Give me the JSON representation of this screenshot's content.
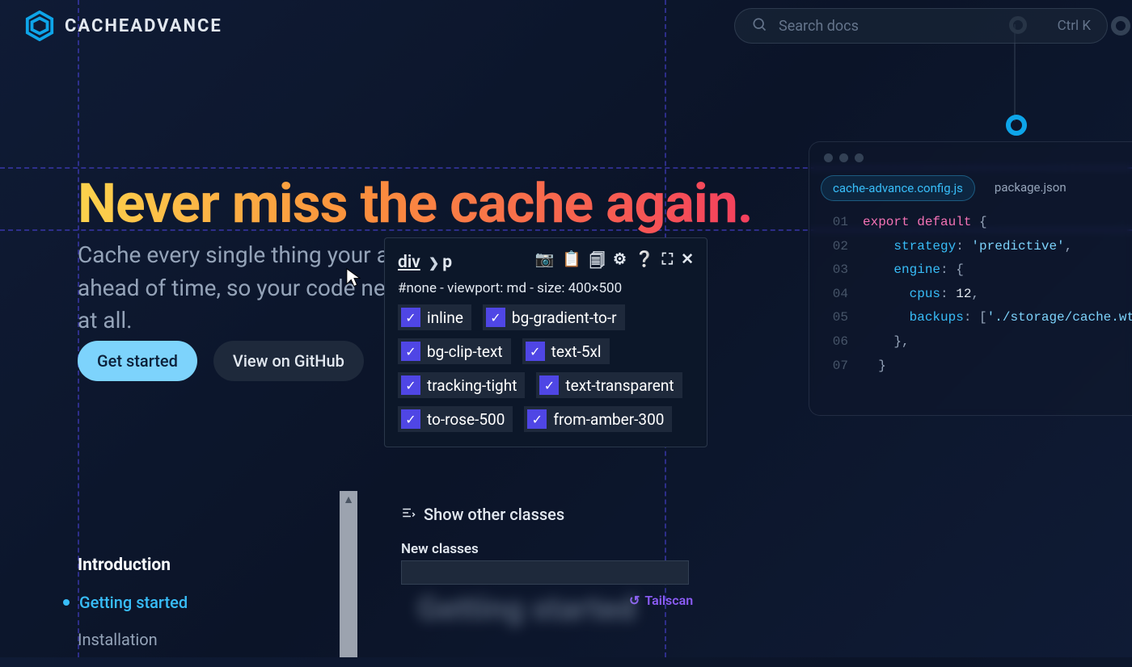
{
  "brand": "CACHEADVANCE",
  "search": {
    "placeholder": "Search docs",
    "kbd": "Ctrl K"
  },
  "hero": {
    "title": "Never miss the cache again.",
    "subtitle": "Cache every single thing your app could ever do ahead of time, so your code never even has to run at all."
  },
  "buttons": {
    "primary": "Get started",
    "secondary": "View on GitHub"
  },
  "sidebar": {
    "section": "Introduction",
    "links": [
      "Getting started",
      "Installation"
    ]
  },
  "inspector": {
    "breadcrumb_parent": "div",
    "breadcrumb_current": "p",
    "meta": "#none - viewport: md - size: 400×500",
    "classes": [
      "inline",
      "bg-gradient-to-r",
      "bg-clip-text",
      "text-5xl",
      "tracking-tight",
      "text-transparent",
      "to-rose-500",
      "from-amber-300"
    ],
    "show_other": "Show other classes",
    "new_classes_label": "New classes",
    "tailscan": "Tailscan"
  },
  "code": {
    "tabs": {
      "active": "cache-advance.config.js",
      "inactive": "package.json"
    },
    "lines": [
      {
        "n": "01",
        "tokens": [
          [
            "red",
            "export"
          ],
          [
            "p",
            " "
          ],
          [
            "red",
            "default"
          ],
          [
            "p",
            " {"
          ]
        ]
      },
      {
        "n": "02",
        "tokens": [
          [
            "p",
            "    "
          ],
          [
            "key",
            "strategy"
          ],
          [
            "p",
            ": "
          ],
          [
            "str",
            "'predictive'"
          ],
          [
            "p",
            ","
          ]
        ]
      },
      {
        "n": "03",
        "tokens": [
          [
            "p",
            "    "
          ],
          [
            "key",
            "engine"
          ],
          [
            "p",
            ": {"
          ]
        ]
      },
      {
        "n": "04",
        "tokens": [
          [
            "p",
            "      "
          ],
          [
            "key",
            "cpus"
          ],
          [
            "p",
            ": "
          ],
          [
            "num",
            "12"
          ],
          [
            "p",
            ","
          ]
        ]
      },
      {
        "n": "05",
        "tokens": [
          [
            "p",
            "      "
          ],
          [
            "key",
            "backups"
          ],
          [
            "p",
            ": ["
          ],
          [
            "str",
            "'./storage/cache.wtf'"
          ],
          [
            "p",
            "],"
          ]
        ]
      },
      {
        "n": "06",
        "tokens": [
          [
            "p",
            "    },"
          ]
        ]
      },
      {
        "n": "07",
        "tokens": [
          [
            "p",
            "  }"
          ]
        ]
      }
    ]
  },
  "blur_heading": "Getting started"
}
